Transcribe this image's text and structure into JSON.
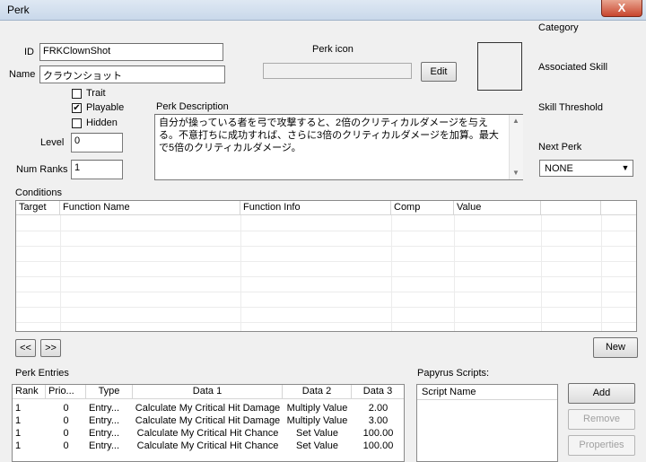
{
  "window": {
    "title": "Perk",
    "close_glyph": "X"
  },
  "form": {
    "id_label": "ID",
    "id_value": "FRKClownShot",
    "name_label": "Name",
    "name_value": "クラウンショット",
    "trait_label": "Trait",
    "trait_checked": false,
    "playable_label": "Playable",
    "playable_checked": true,
    "hidden_label": "Hidden",
    "hidden_checked": false,
    "level_label": "Level",
    "level_value": "0",
    "num_ranks_label": "Num Ranks",
    "num_ranks_value": "1",
    "perk_icon_label": "Perk icon",
    "perk_icon_value": "",
    "edit_label": "Edit",
    "description_label": "Perk Description",
    "description_value": "自分が操っている者を弓で攻撃すると、2倍のクリティカルダメージを与える。不意打ちに成功すれば、さらに3倍のクリティカルダメージを加算。最大で5倍のクリティカルダメージ。"
  },
  "right_panel": {
    "category_label": "Category",
    "associated_skill_label": "Associated Skill",
    "skill_threshold_label": "Skill Threshold",
    "next_perk_label": "Next Perk",
    "next_perk_value": "NONE"
  },
  "conditions": {
    "label": "Conditions",
    "columns": [
      "Target",
      "Function Name",
      "Function Info",
      "Comp",
      "Value",
      "",
      ""
    ],
    "prev_label": "<<",
    "next_label": ">>",
    "new_label": "New"
  },
  "perk_entries": {
    "label": "Perk Entries",
    "columns": [
      "Rank",
      "Prio...",
      "Type",
      "Data 1",
      "Data 2",
      "Data 3"
    ],
    "rows": [
      [
        "1",
        "0",
        "Entry...",
        "Calculate My Critical Hit Damage",
        "Multiply Value",
        "2.00"
      ],
      [
        "1",
        "0",
        "Entry...",
        "Calculate My Critical Hit Damage",
        "Multiply Value",
        "3.00"
      ],
      [
        "1",
        "0",
        "Entry...",
        "Calculate My Critical Hit Chance",
        "Set Value",
        "100.00"
      ],
      [
        "1",
        "0",
        "Entry...",
        "Calculate My Critical Hit Chance",
        "Set Value",
        "100.00"
      ]
    ]
  },
  "papyrus": {
    "label": "Papyrus Scripts:",
    "column": "Script Name",
    "add_label": "Add",
    "remove_label": "Remove",
    "properties_label": "Properties"
  }
}
